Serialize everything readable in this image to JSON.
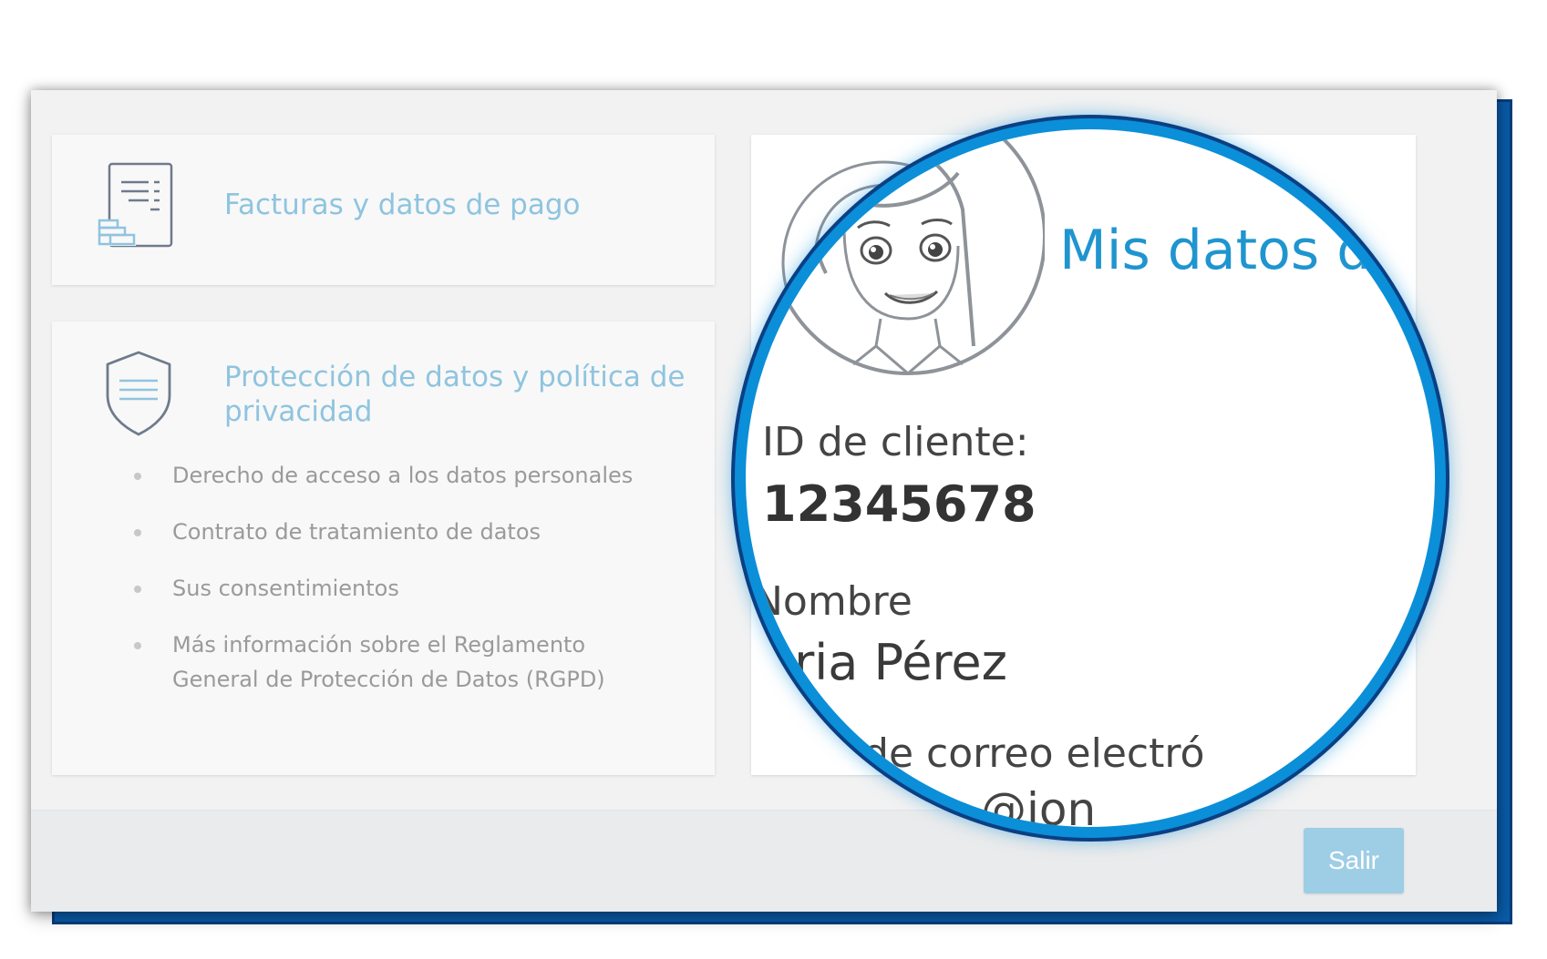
{
  "invoices_card": {
    "title": "Facturas y datos de pago",
    "icon": "invoice-icon"
  },
  "privacy_card": {
    "title": "Protección de datos y política de privacidad",
    "icon": "shield-icon",
    "items": [
      {
        "label": "Derecho de acceso a los datos personales"
      },
      {
        "label": "Contrato de tratamiento de datos"
      },
      {
        "label": "Sus consentimientos"
      },
      {
        "label": "Más información sobre el Reglamento General de Protección de Datos (RGPD)"
      }
    ]
  },
  "my_data_card": {
    "title": "Mis datos de",
    "avatar_icon": "user-avatar-icon",
    "customer_id_label": "ID de cliente:",
    "customer_id_value": "12345678",
    "name_label": "Nombre",
    "name_value": "aria Pérez",
    "email_label": "ión de correo electró",
    "email_value": "@ion"
  },
  "footer": {
    "exit_label": "Salir"
  },
  "colors": {
    "accent": "#1f95cf",
    "link_light": "#8fc4df",
    "button": "#9ecde6",
    "magnifier_ring": "#0b8fd8",
    "frame_blue": "#0a5ba8"
  }
}
